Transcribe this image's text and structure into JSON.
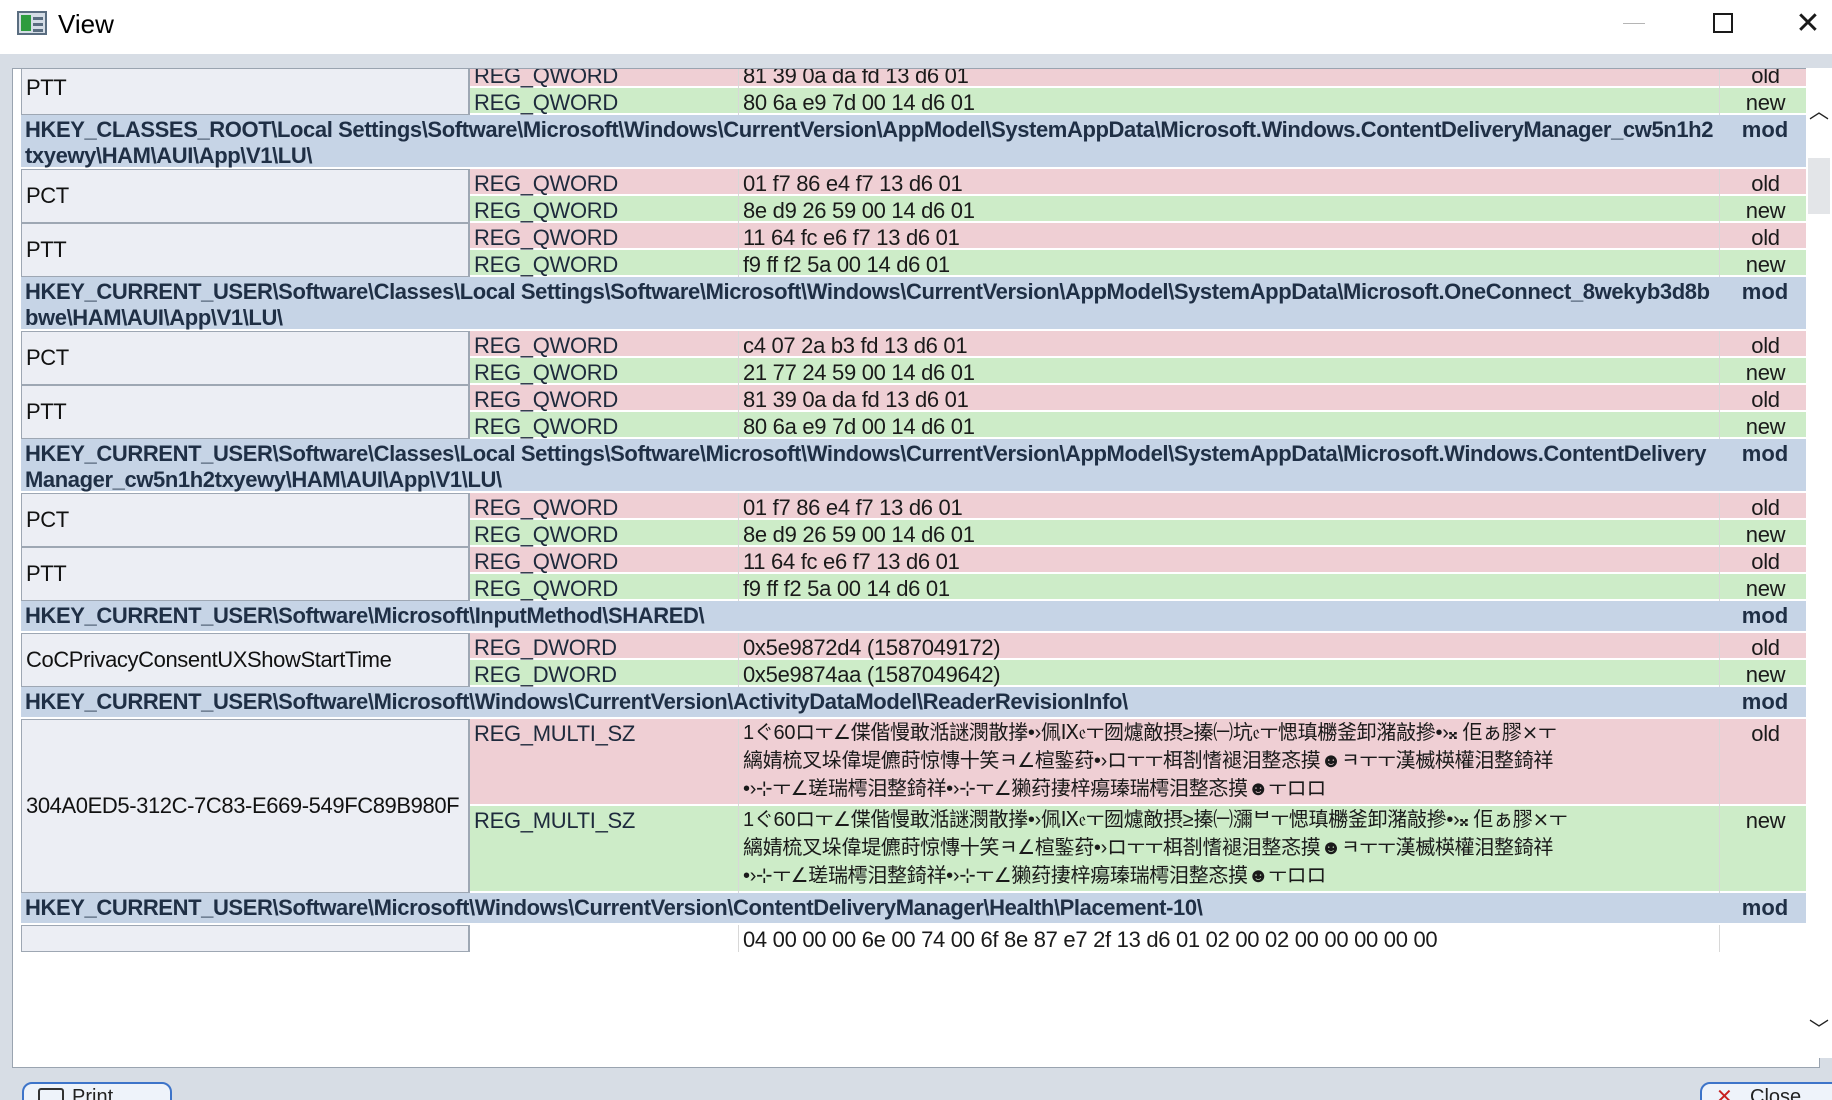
{
  "window": {
    "title": "View"
  },
  "groups": [
    {
      "values": [
        {
          "name": "PTT",
          "rows": [
            {
              "type": "REG_QWORD",
              "value": "81 39 0a da fd 13 d6 01",
              "status": "old"
            },
            {
              "type": "REG_QWORD",
              "value": "80 6a e9 7d 00 14 d6 01",
              "status": "new"
            }
          ]
        }
      ]
    },
    {
      "key": "HKEY_CLASSES_ROOT\\Local Settings\\Software\\Microsoft\\Windows\\CurrentVersion\\AppModel\\SystemAppData\\Microsoft.Windows.ContentDeliveryManager_cw5n1h2txyewy\\HAM\\AUI\\App\\V1\\LU\\",
      "status": "mod",
      "values": [
        {
          "name": "PCT",
          "rows": [
            {
              "type": "REG_QWORD",
              "value": "01 f7 86 e4 f7 13 d6 01",
              "status": "old"
            },
            {
              "type": "REG_QWORD",
              "value": "8e d9 26 59 00 14 d6 01",
              "status": "new"
            }
          ]
        },
        {
          "name": "PTT",
          "rows": [
            {
              "type": "REG_QWORD",
              "value": "11 64 fc e6 f7 13 d6 01",
              "status": "old"
            },
            {
              "type": "REG_QWORD",
              "value": "f9 ff f2 5a 00 14 d6 01",
              "status": "new"
            }
          ]
        }
      ]
    },
    {
      "key": "HKEY_CURRENT_USER\\Software\\Classes\\Local Settings\\Software\\Microsoft\\Windows\\CurrentVersion\\AppModel\\SystemAppData\\Microsoft.OneConnect_8wekyb3d8bbwe\\HAM\\AUI\\App\\V1\\LU\\",
      "status": "mod",
      "values": [
        {
          "name": "PCT",
          "rows": [
            {
              "type": "REG_QWORD",
              "value": "c4 07 2a b3 fd 13 d6 01",
              "status": "old"
            },
            {
              "type": "REG_QWORD",
              "value": "21 77 24 59 00 14 d6 01",
              "status": "new"
            }
          ]
        },
        {
          "name": "PTT",
          "rows": [
            {
              "type": "REG_QWORD",
              "value": "81 39 0a da fd 13 d6 01",
              "status": "old"
            },
            {
              "type": "REG_QWORD",
              "value": "80 6a e9 7d 00 14 d6 01",
              "status": "new"
            }
          ]
        }
      ]
    },
    {
      "key": "HKEY_CURRENT_USER\\Software\\Classes\\Local Settings\\Software\\Microsoft\\Windows\\CurrentVersion\\AppModel\\SystemAppData\\Microsoft.Windows.ContentDeliveryManager_cw5n1h2txyewy\\HAM\\AUI\\App\\V1\\LU\\",
      "status": "mod",
      "values": [
        {
          "name": "PCT",
          "rows": [
            {
              "type": "REG_QWORD",
              "value": "01 f7 86 e4 f7 13 d6 01",
              "status": "old"
            },
            {
              "type": "REG_QWORD",
              "value": "8e d9 26 59 00 14 d6 01",
              "status": "new"
            }
          ]
        },
        {
          "name": "PTT",
          "rows": [
            {
              "type": "REG_QWORD",
              "value": "11 64 fc e6 f7 13 d6 01",
              "status": "old"
            },
            {
              "type": "REG_QWORD",
              "value": "f9 ff f2 5a 00 14 d6 01",
              "status": "new"
            }
          ]
        }
      ]
    },
    {
      "key": "HKEY_CURRENT_USER\\Software\\Microsoft\\InputMethod\\SHARED\\",
      "status": "mod",
      "values": [
        {
          "name": "CoCPrivacyConsentUXShowStartTime",
          "rows": [
            {
              "type": "REG_DWORD",
              "value": "0x5e9872d4 (1587049172)",
              "status": "old"
            },
            {
              "type": "REG_DWORD",
              "value": "0x5e9874aa (1587049642)",
              "status": "new"
            }
          ]
        }
      ]
    },
    {
      "key": "HKEY_CURRENT_USER\\Software\\Microsoft\\Windows\\CurrentVersion\\ActivityDataModel\\ReaderRevisionInfo\\",
      "status": "mod",
      "values": [
        {
          "name": "304A0ED5-312C-7C83-E669-549FC89B980F",
          "multi": true,
          "rows": [
            {
              "type": "REG_MULTI_SZ",
              "value": "1ぐ60ロㅜ∠偞偕慢敢湉謎潣散搼•›佩Ⅸ𝔢ㅜ囫爈敵摂≥搸㈠坑𝔢ㅜ愢瑱橳釜卸潴敲摻•›𝄪 佢ぁ膠⨯ㅜ縭婧梳叉垛偉堤儦莳惊慱十笑ㅋ∠楦鍳荮•›ロㅜㅜ栮剳愭褪泪整忞摸☻ㅋㅜㅜ漢楲楧權泪整錡祥•›⊹ㅜ∠瑳瑞樗泪整錡祥•›⊹ㅜ∠獭荮捿梓瘍瑧瑞樗泪整忞摸☻ㅜロロ",
              "status": "old"
            },
            {
              "type": "REG_MULTI_SZ",
              "value": "1ぐ60ロㅜ∠偞偕慢敢湉謎潣散搼•›佩Ⅸ𝔢ㅜ囫爈敵摂≥搸㈠瀰ᄇㅜ愢瑱橳釜卸潴敲摻•›𝄪 佢ぁ膠⨯ㅜ縭婧梳叉垛偉堤儦莳惊慱十笑ㅋ∠楦鍳荮•›ロㅜㅜ栮剳愭褪泪整忞摸☻ㅋㅜㅜ漢楲楧權泪整錡祥•›⊹ㅜ∠瑳瑞樗泪整錡祥•›⊹ㅜ∠獭荮捿梓瘍瑧瑞樗泪整忞摸☻ㅜロロ",
              "status": "new"
            }
          ]
        }
      ]
    },
    {
      "key": "HKEY_CURRENT_USER\\Software\\Microsoft\\Windows\\CurrentVersion\\ContentDeliveryManager\\Health\\Placement-10\\",
      "status": "mod",
      "values": [
        {
          "name": "",
          "partial": true,
          "rows": [
            {
              "type": "",
              "value": "04 00 00 00 6e 00 74 00 6f 8e 87 e7 2f 13 d6 01 02 00 02 00 00 00 00 00",
              "status": ""
            }
          ]
        }
      ]
    }
  ],
  "buttons": {
    "print": "Print",
    "close": "Close"
  },
  "colors": {
    "old_row": "#efcfd4",
    "new_row": "#cdecc8",
    "key_row": "#c6d4e6",
    "name_cell": "#eceef4"
  }
}
